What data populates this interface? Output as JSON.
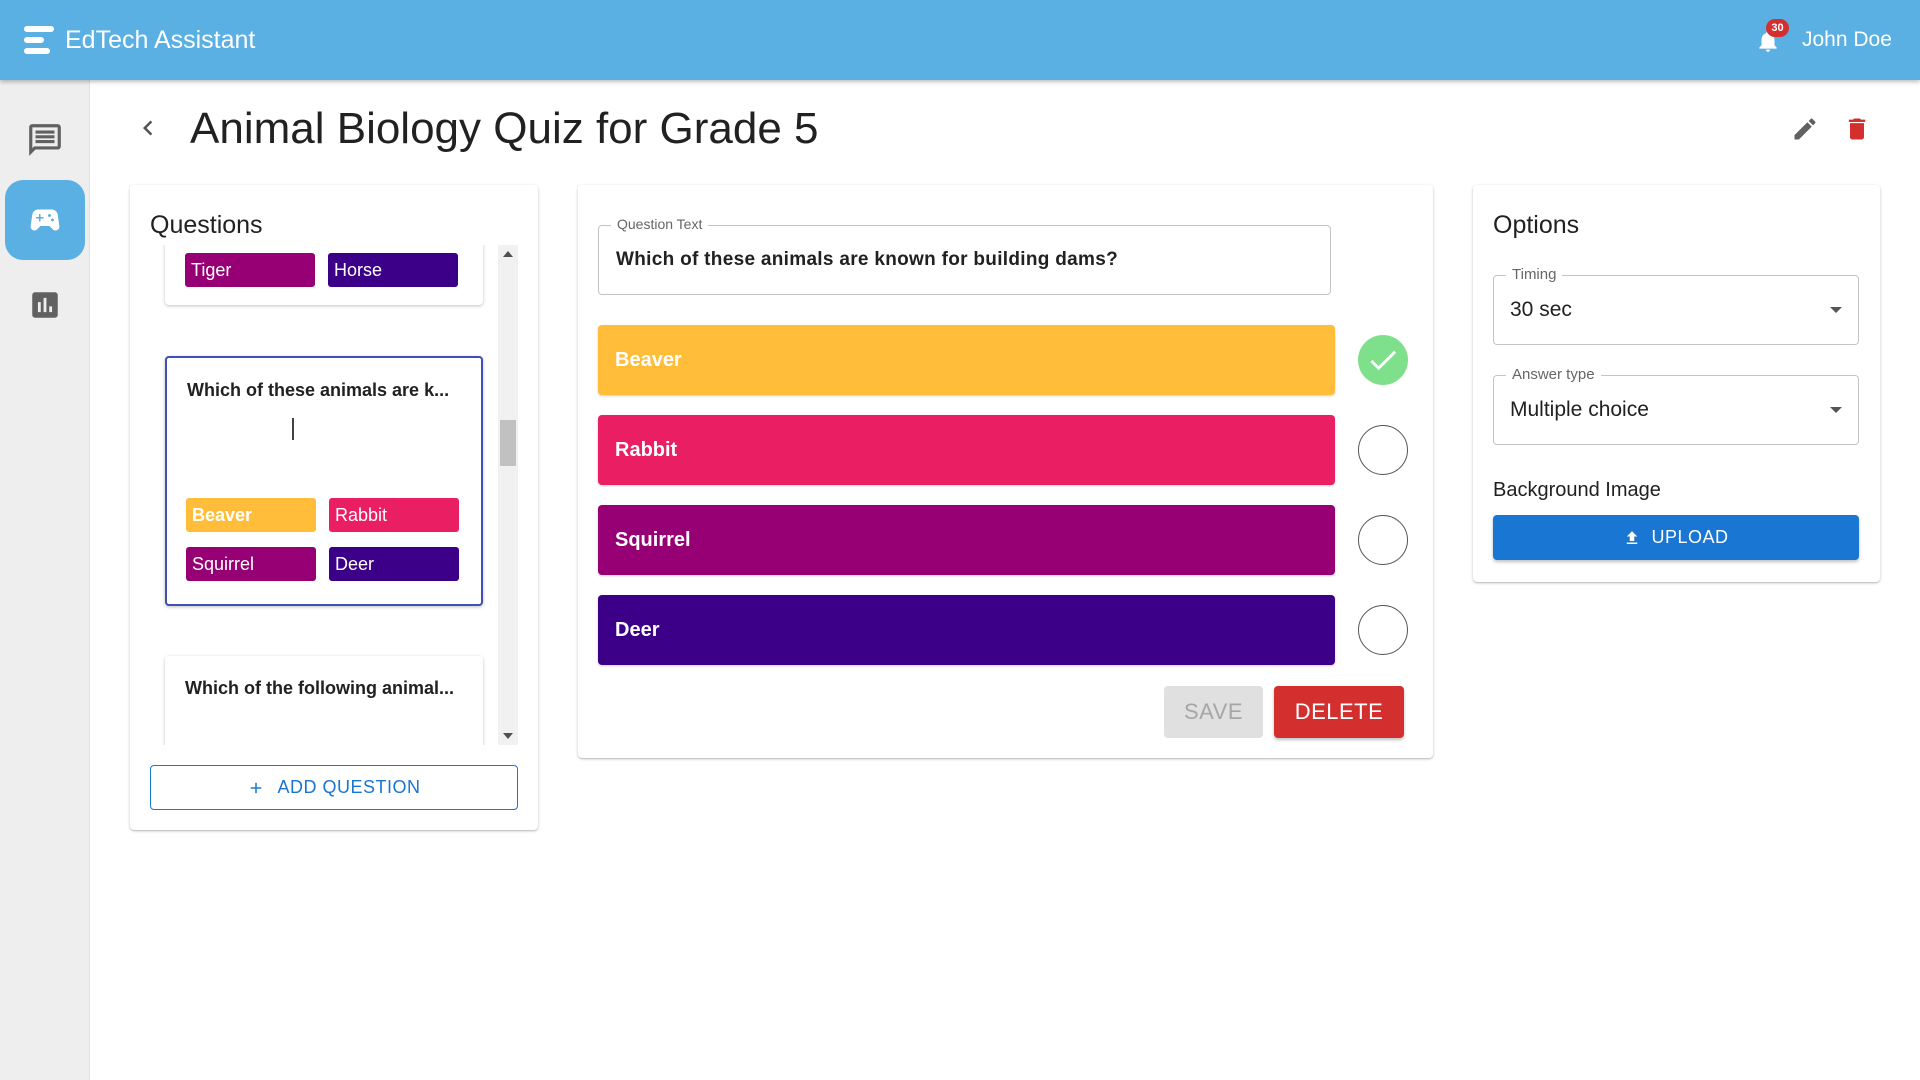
{
  "app": {
    "title": "EdTech Assistant",
    "notification_count": "30",
    "user_name": "John Doe"
  },
  "sidebar": {
    "items": [
      {
        "name": "chat",
        "icon": "chat-icon",
        "active": false
      },
      {
        "name": "games",
        "icon": "gamepad-icon",
        "active": true
      },
      {
        "name": "analytics",
        "icon": "bar-chart-icon",
        "active": false
      }
    ]
  },
  "header": {
    "title": "Animal Biology Quiz for Grade 5"
  },
  "questions_panel": {
    "title": "Questions",
    "items": [
      {
        "text": "",
        "answers": [
          {
            "label": "Tiger",
            "color": "#970074"
          },
          {
            "label": "Horse",
            "color": "#3c0088"
          }
        ]
      },
      {
        "text": "Which of these animals are k...",
        "selected": true,
        "answers": [
          {
            "label": "Beaver",
            "color": "#ffbd3a"
          },
          {
            "label": "Rabbit",
            "color": "#e91e63"
          },
          {
            "label": "Squirrel",
            "color": "#970074"
          },
          {
            "label": "Deer",
            "color": "#3c0088"
          }
        ]
      },
      {
        "text": "Which of the following animal...",
        "answers": []
      }
    ],
    "add_button_label": "ADD QUESTION"
  },
  "editor": {
    "question_label": "Question Text",
    "question_text": "Which of these animals are known for building dams?",
    "answers": [
      {
        "label": "Beaver",
        "color": "#ffbd3a",
        "correct": true
      },
      {
        "label": "Rabbit",
        "color": "#e91e63",
        "correct": false
      },
      {
        "label": "Squirrel",
        "color": "#970074",
        "correct": false
      },
      {
        "label": "Deer",
        "color": "#3c0088",
        "correct": false
      }
    ],
    "save_label": "SAVE",
    "delete_label": "DELETE"
  },
  "options": {
    "title": "Options",
    "timing_label": "Timing",
    "timing_value": "30 sec",
    "answer_type_label": "Answer type",
    "answer_type_value": "Multiple choice",
    "background_label": "Background Image",
    "upload_label": "UPLOAD"
  },
  "colors": {
    "appbar": "#5aafe3",
    "primary": "#1976d2",
    "danger": "#d32f2f",
    "correct": "#7ee08a"
  }
}
